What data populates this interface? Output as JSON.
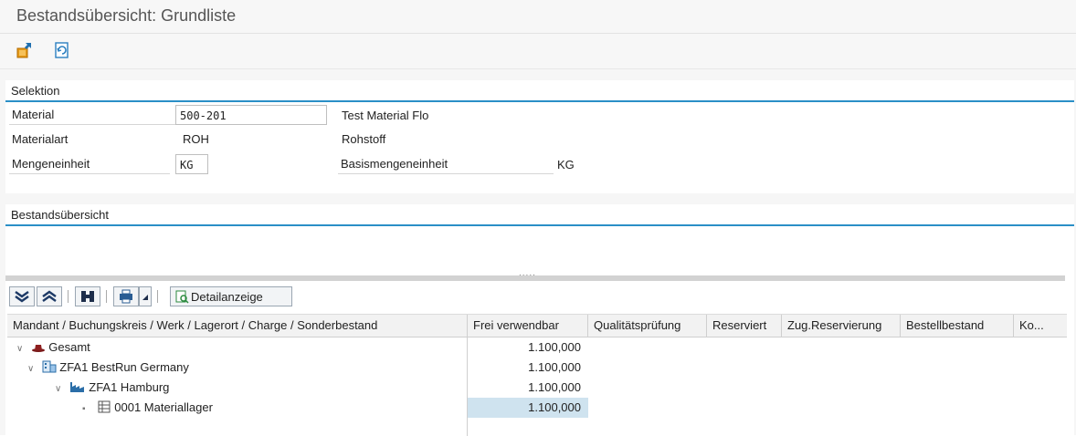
{
  "window": {
    "title": "Bestandsübersicht: Grundliste"
  },
  "appbar": {
    "icons": [
      "export-icon",
      "refresh-icon"
    ]
  },
  "selektion": {
    "header": "Selektion",
    "material_label": "Material",
    "material_value": "500-201",
    "material_desc": "Test Material Flo",
    "materialart_label": "Materialart",
    "materialart_value": "ROH",
    "materialart_desc": "Rohstoff",
    "mengeneinheit_label": "Mengeneinheit",
    "mengeneinheit_value": "KG",
    "basis_label": "Basismengeneinheit",
    "basis_value": "KG"
  },
  "bestand": {
    "header": "Bestandsübersicht"
  },
  "splitter": {
    "grip": "....."
  },
  "toolbar": {
    "detail_label": "Detailanzeige"
  },
  "grid": {
    "columns": [
      "Mandant / Buchungskreis / Werk / Lagerort / Charge / Sonderbestand",
      "Frei verwendbar",
      "Qualitätsprüfung",
      "Reserviert",
      "Zug.Reservierung",
      "Bestellbestand",
      "Ko..."
    ],
    "rows": [
      {
        "label": "Gesamt",
        "frei": "1.100,000"
      },
      {
        "label": "ZFA1 BestRun Germany",
        "frei": "1.100,000"
      },
      {
        "label": "ZFA1 Hamburg",
        "frei": "1.100,000"
      },
      {
        "label": "0001 Materiallager",
        "frei": "1.100,000"
      }
    ]
  }
}
